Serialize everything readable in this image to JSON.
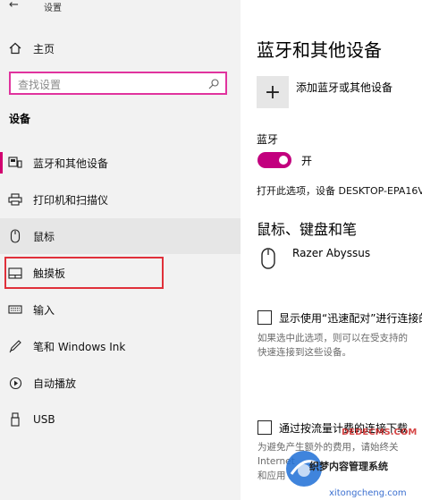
{
  "window": {
    "title": "设置",
    "back_icon": "back-arrow-icon"
  },
  "sidebar": {
    "home": {
      "label": "主页",
      "icon": "home-icon"
    },
    "search": {
      "placeholder": "查找设置",
      "icon": "search-icon"
    },
    "section": "设备",
    "items": [
      {
        "label": "蓝牙和其他设备",
        "icon": "bluetooth-devices-icon"
      },
      {
        "label": "打印机和扫描仪",
        "icon": "printer-icon"
      },
      {
        "label": "鼠标",
        "icon": "mouse-icon"
      },
      {
        "label": "触摸板",
        "icon": "touchpad-icon"
      },
      {
        "label": "输入",
        "icon": "keyboard-icon"
      },
      {
        "label": "笔和 Windows Ink",
        "icon": "pen-icon"
      },
      {
        "label": "自动播放",
        "icon": "autoplay-icon"
      },
      {
        "label": "USB",
        "icon": "usb-icon"
      }
    ],
    "active_index": 0,
    "hover_index": 2,
    "highlighted_index": 3
  },
  "main": {
    "title": "蓝牙和其他设备",
    "add_label": "添加蓝牙或其他设备",
    "bluetooth_label": "蓝牙",
    "toggle_state": "开",
    "toggle_on": true,
    "discoverable_text": "打开此选项，设备 DESKTOP-EPA16V",
    "mouse_section_title": "鼠标、键盘和笔",
    "device_name": "Razer Abyssus",
    "swift_pair": {
      "label": "显示使用“迅速配对”进行连接的",
      "desc_line1": "如果选中此选项，则可以在受支持的",
      "desc_line2": "快速连接到这些设备。",
      "checked": false
    },
    "metered": {
      "label": "通过按流量计费的连接下载",
      "desc_line1": "为避免产生额外的费用，请始终关",
      "desc_line2": "Internet",
      "desc_line3": "和应用",
      "checked": false
    }
  },
  "watermark": {
    "line1": "DEDECMS.COM",
    "line2": "织梦内容管理系统",
    "line3": "xitongcheng.com"
  },
  "colors": {
    "accent": "#c2007e",
    "search_border": "#e0339e",
    "highlight_border": "#e0303a",
    "sidebar_bg": "#f2f2f2"
  }
}
